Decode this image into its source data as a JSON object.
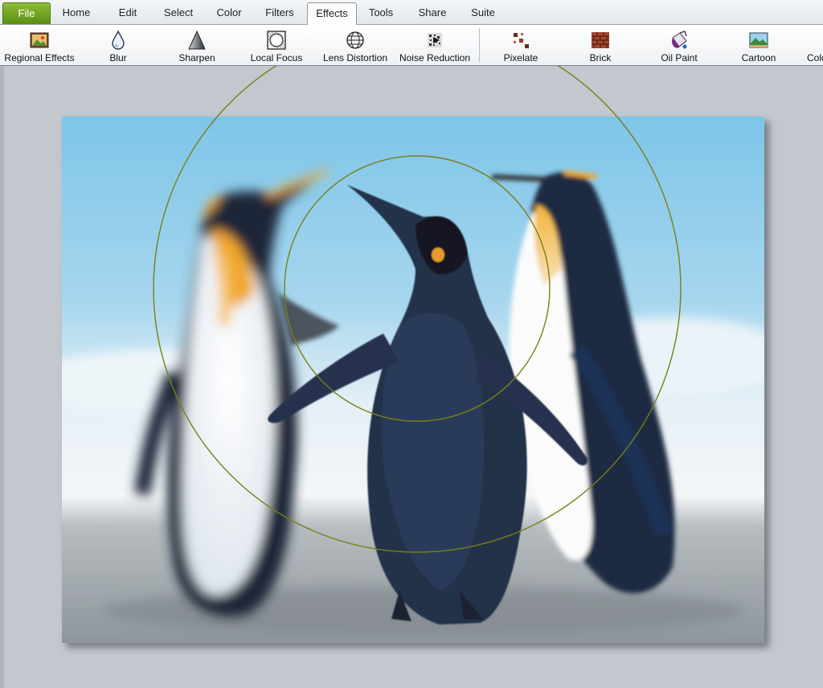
{
  "menu": {
    "tabs": [
      "File",
      "Home",
      "Edit",
      "Select",
      "Color",
      "Filters",
      "Effects",
      "Tools",
      "Share",
      "Suite"
    ],
    "active_tab": "Effects"
  },
  "ribbon": {
    "tools": [
      {
        "label": "Regional Effects",
        "icon": "regional-effects-icon"
      },
      {
        "label": "Blur",
        "icon": "water-drop-icon"
      },
      {
        "label": "Sharpen",
        "icon": "triangle-icon"
      },
      {
        "label": "Local Focus",
        "icon": "local-focus-icon"
      },
      {
        "label": "Lens Distortion",
        "icon": "globe-grid-icon"
      },
      {
        "label": "Noise Reduction",
        "icon": "noise-icon"
      },
      {
        "label": "Pixelate",
        "icon": "pixel-squares-icon"
      },
      {
        "label": "Brick",
        "icon": "brick-wall-icon"
      },
      {
        "label": "Oil Paint",
        "icon": "paint-bucket-icon"
      },
      {
        "label": "Cartoon",
        "icon": "landscape-icon"
      },
      {
        "label": "Colo",
        "icon": "color-icon"
      }
    ]
  },
  "canvas": {
    "image_subject": "three king penguins photo with local focus effect",
    "focus_guide_color": "#7a7f1a"
  },
  "colors": {
    "file_tab": "#6c9c1f",
    "workspace": "#c2c8cd"
  }
}
